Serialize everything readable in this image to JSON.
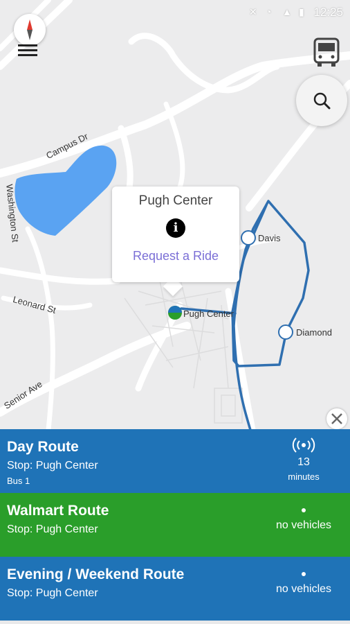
{
  "status_bar": {
    "time": "12:25"
  },
  "map": {
    "labels": {
      "campus_dr": "Campus Dr",
      "washington": "Washington St",
      "leonard": "Leonard St",
      "senior": "Senior Ave",
      "davis": "Davis",
      "diamond": "Diamond",
      "pugh": "Pugh Center"
    }
  },
  "popup": {
    "title": "Pugh Center",
    "info_glyph": "i",
    "request_label": "Request a Ride"
  },
  "routes": [
    {
      "name": "Day Route",
      "stop": "Stop: Pugh Center",
      "bus": "Bus 1",
      "eta_value": "13",
      "eta_unit": "minutes",
      "color": "#1f73b7"
    },
    {
      "name": "Walmart Route",
      "stop": "Stop: Pugh Center",
      "status": "no vehicles",
      "color": "#2a9e2a"
    },
    {
      "name": "Evening / Weekend Route",
      "stop": "Stop: Pugh Center",
      "status": "no vehicles",
      "color": "#1f73b7"
    }
  ],
  "colors": {
    "route_line": "#2f6fb0",
    "lake": "#5aa3f2",
    "map_bg": "#ececed",
    "road": "#ffffff"
  }
}
